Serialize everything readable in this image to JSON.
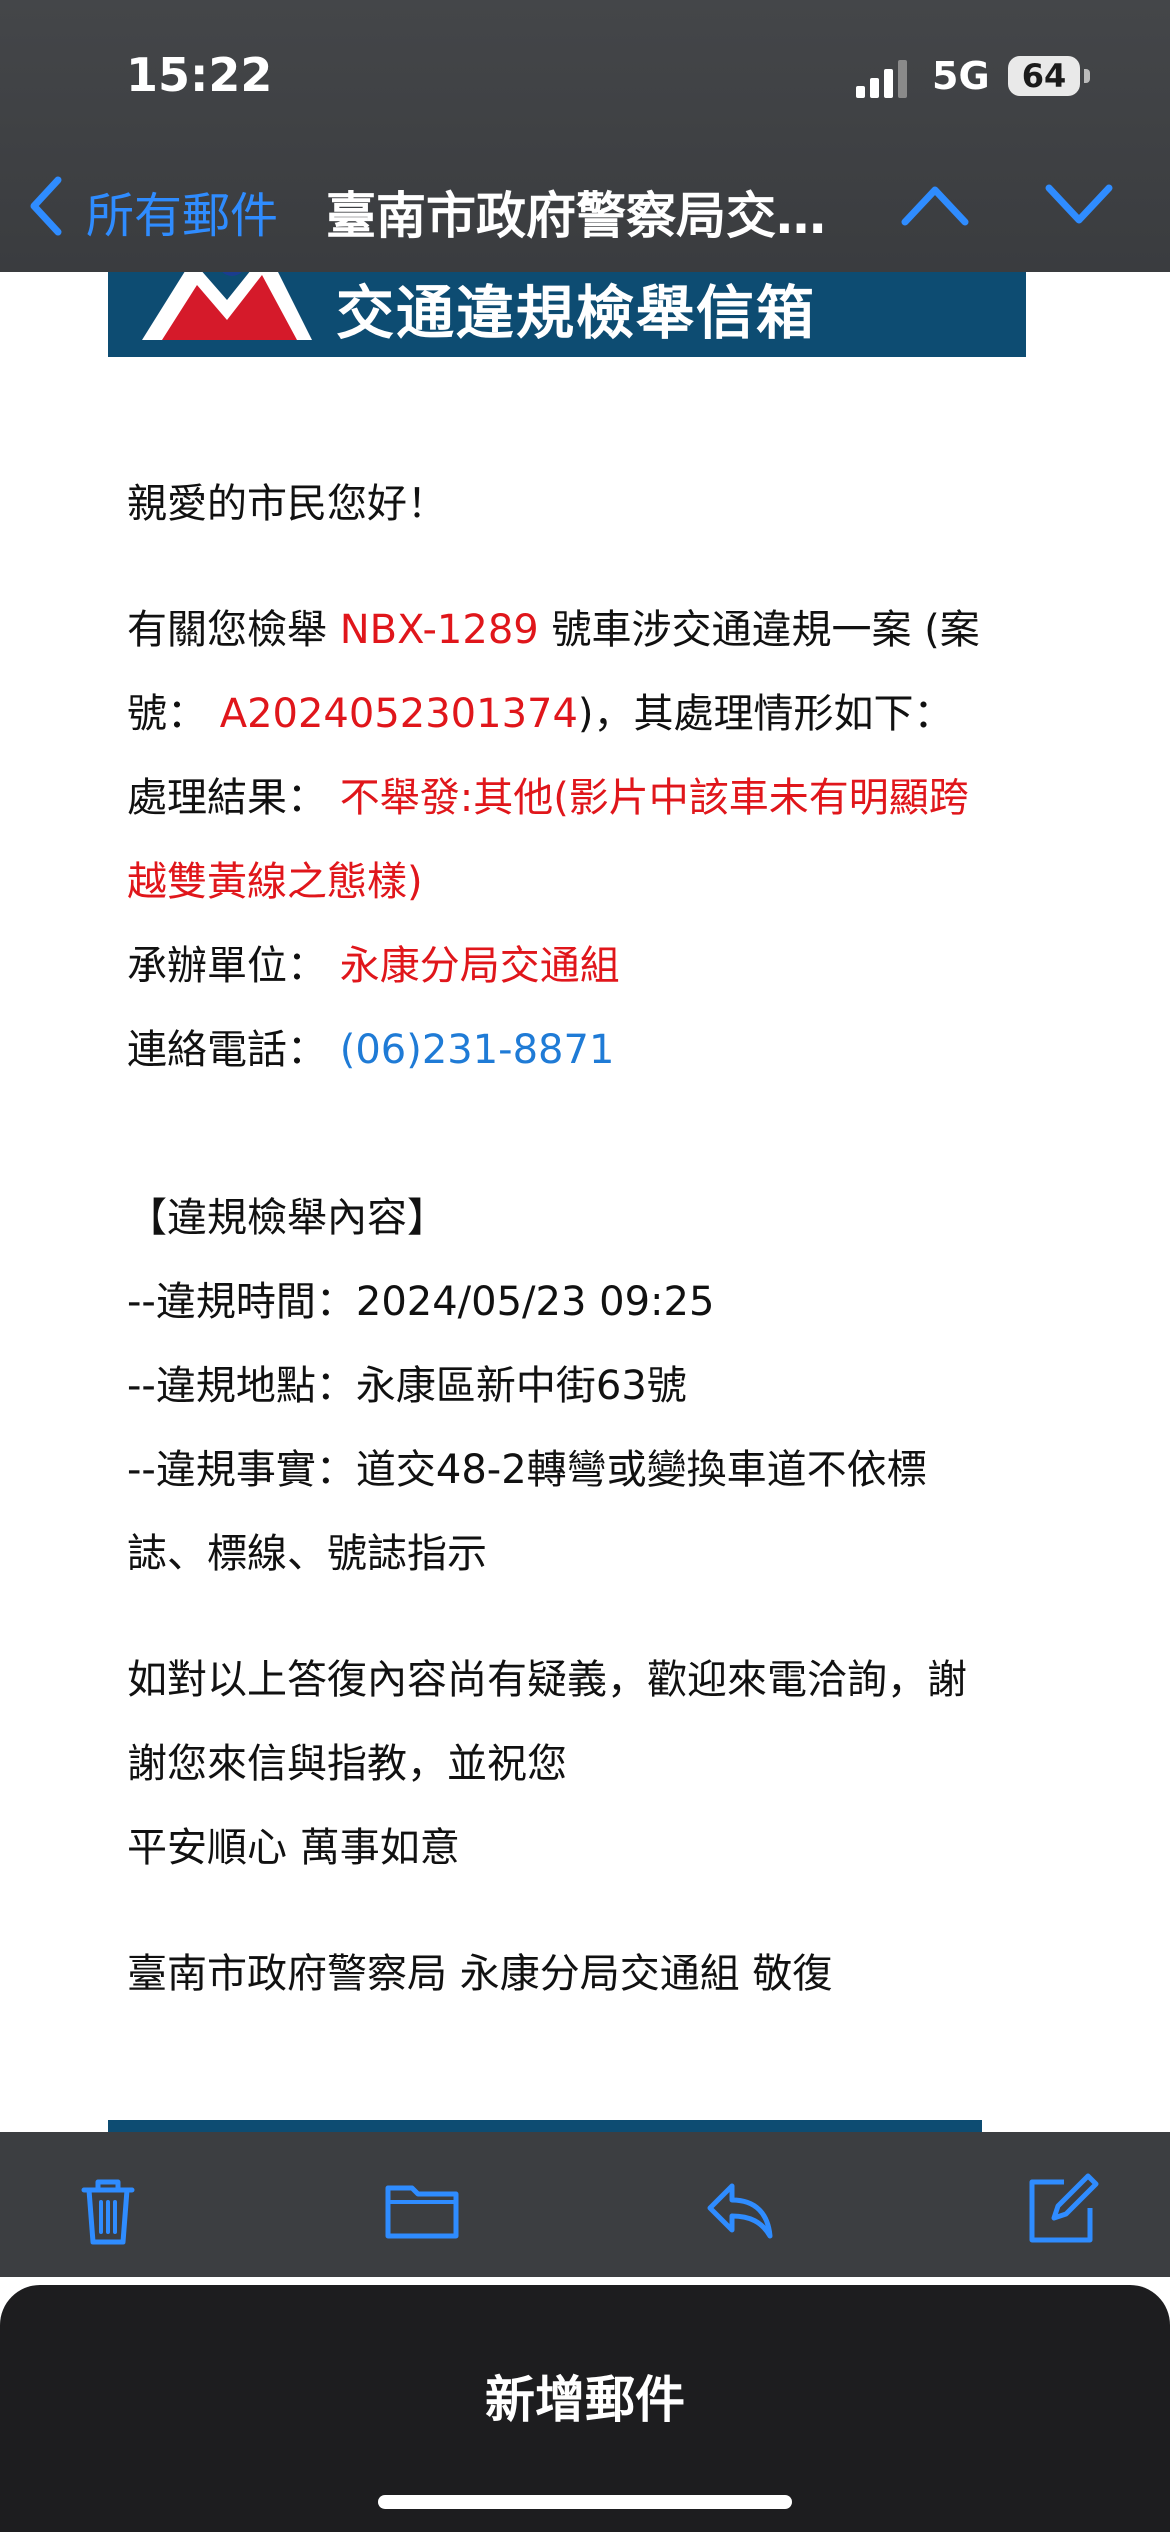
{
  "status_bar": {
    "time": "15:22",
    "network": "5G",
    "battery": "64"
  },
  "nav": {
    "back_label": "所有郵件",
    "title": "臺南市政府警察局交…"
  },
  "email": {
    "banner_title": "交通違規檢舉信箱",
    "greeting": "親愛的市民您好！",
    "intro_prefix": "有關您檢舉",
    "plate": "NBX-1289",
    "intro_suffix": "號車涉交通違規一案 (案",
    "case_label": "號：",
    "case_number": "A2024052301374",
    "case_suffix": ")，其處理情形如下：",
    "result_label": "處理結果：",
    "result_line1": "不舉發:其他(影片中該車未有明顯跨",
    "result_line2": "越雙黃線之態樣)",
    "unit_label": "承辦單位：",
    "unit_value": "永康分局交通組",
    "phone_label": "連絡電話：",
    "phone_value": "(06)231-8871",
    "section_title": "【違規檢舉內容】",
    "time_line": "--違規時間：2024/05/23 09:25",
    "place_line": "--違規地點：永康區新中街63號",
    "fact_line1": "--違規事實：道交48-2轉彎或變換車道不依標",
    "fact_line2": "誌、標線、號誌指示",
    "closing_line1": "如對以上答復內容尚有疑義，歡迎來電洽詢，謝",
    "closing_line2": "謝您來信與指教，並祝您",
    "closing_line3": "平安順心 萬事如意",
    "signature": "臺南市政府警察局 永康分局交通組 敬復"
  },
  "toolbar": {
    "icons": [
      "trash-icon",
      "folder-icon",
      "reply-icon",
      "compose-icon"
    ]
  },
  "compose": {
    "label": "新增郵件"
  },
  "colors": {
    "accent": "#2f8cff",
    "highlight_red": "#e0161b",
    "link_blue": "#1f7bd6",
    "banner": "#0d4c72"
  }
}
